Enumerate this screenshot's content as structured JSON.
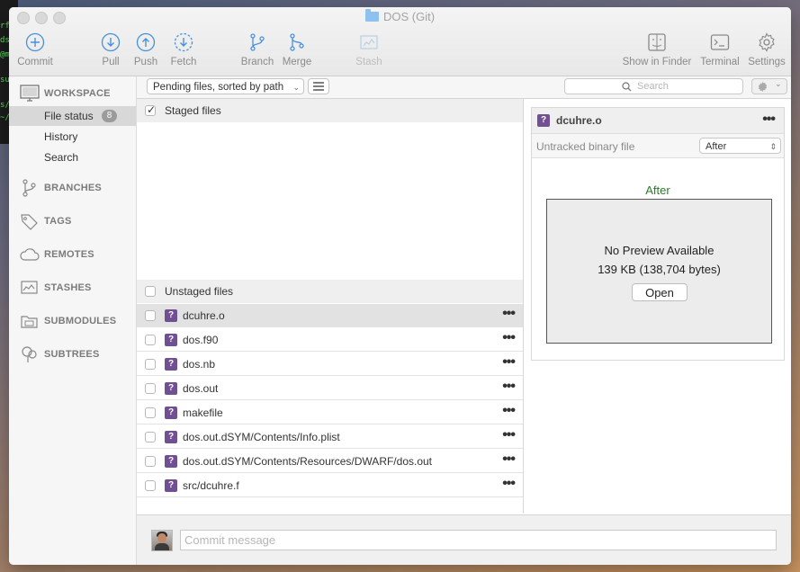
{
  "window": {
    "title": "DOS (Git)"
  },
  "terminal": {
    "lines": [
      "rf",
      "ds",
      "@m",
      "su",
      "s/",
      "~/"
    ]
  },
  "toolbar": {
    "commit": "Commit",
    "pull": "Pull",
    "push": "Push",
    "fetch": "Fetch",
    "branch": "Branch",
    "merge": "Merge",
    "stash": "Stash",
    "show_in_finder": "Show in Finder",
    "terminal": "Terminal",
    "settings": "Settings"
  },
  "sidebar": {
    "workspace": "WORKSPACE",
    "items": [
      {
        "label": "File status",
        "count": "8"
      },
      {
        "label": "History"
      },
      {
        "label": "Search"
      }
    ],
    "sections": [
      "BRANCHES",
      "TAGS",
      "REMOTES",
      "STASHES",
      "SUBMODULES",
      "SUBTREES"
    ]
  },
  "filter": {
    "mode": "Pending files, sorted by path",
    "search_placeholder": "Search"
  },
  "staged": {
    "header": "Staged files"
  },
  "unstaged": {
    "header": "Unstaged files",
    "badge": "?",
    "files": [
      "dcuhre.o",
      "dos.f90",
      "dos.nb",
      "dos.out",
      "makefile",
      "dos.out.dSYM/Contents/Info.plist",
      "dos.out.dSYM/Contents/Resources/DWARF/dos.out",
      "src/dcuhre.f"
    ]
  },
  "preview": {
    "filename": "dcuhre.o",
    "type": "Untracked binary file",
    "mode": "After",
    "heading": "After",
    "no_preview": "No Preview Available",
    "size": "139 KB (138,704 bytes)",
    "open": "Open"
  },
  "commit": {
    "placeholder": "Commit message"
  },
  "colors": {
    "badge": "#714f93",
    "after_heading": "#2c7a2c"
  }
}
